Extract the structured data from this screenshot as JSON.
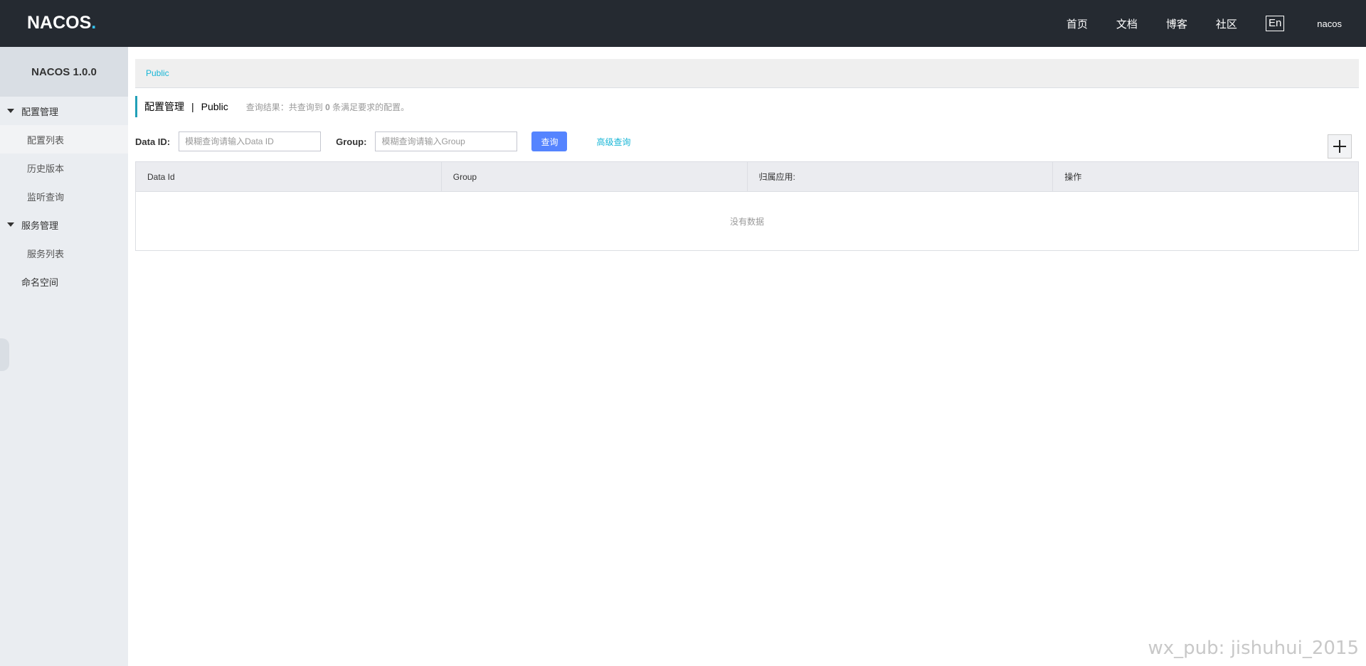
{
  "header": {
    "logo_text": "NACOS",
    "logo_dot": ".",
    "nav": [
      "首页",
      "文档",
      "博客",
      "社区"
    ],
    "lang": "En",
    "user": "nacos"
  },
  "sidebar": {
    "title": "NACOS 1.0.0",
    "groups": [
      {
        "label": "配置管理",
        "items": [
          "配置列表",
          "历史版本",
          "监听查询"
        ]
      },
      {
        "label": "服务管理",
        "items": [
          "服务列表"
        ]
      }
    ],
    "namespace": "命名空间"
  },
  "namespace_bar": {
    "active": "Public"
  },
  "page": {
    "title": "配置管理",
    "separator": "|",
    "namespace": "Public",
    "result_prefix": "查询结果：共查询到",
    "result_count": "0",
    "result_suffix": "条满足要求的配置。"
  },
  "query": {
    "dataid_label": "Data ID:",
    "dataid_placeholder": "模糊查询请输入Data ID",
    "group_label": "Group:",
    "group_placeholder": "模糊查询请输入Group",
    "search_label": "查询",
    "advanced_label": "高级查询"
  },
  "table": {
    "columns": [
      "Data Id",
      "Group",
      "归属应用:",
      "操作"
    ],
    "empty_text": "没有数据"
  },
  "watermark": "wx_pub: jishuhui_2015"
}
